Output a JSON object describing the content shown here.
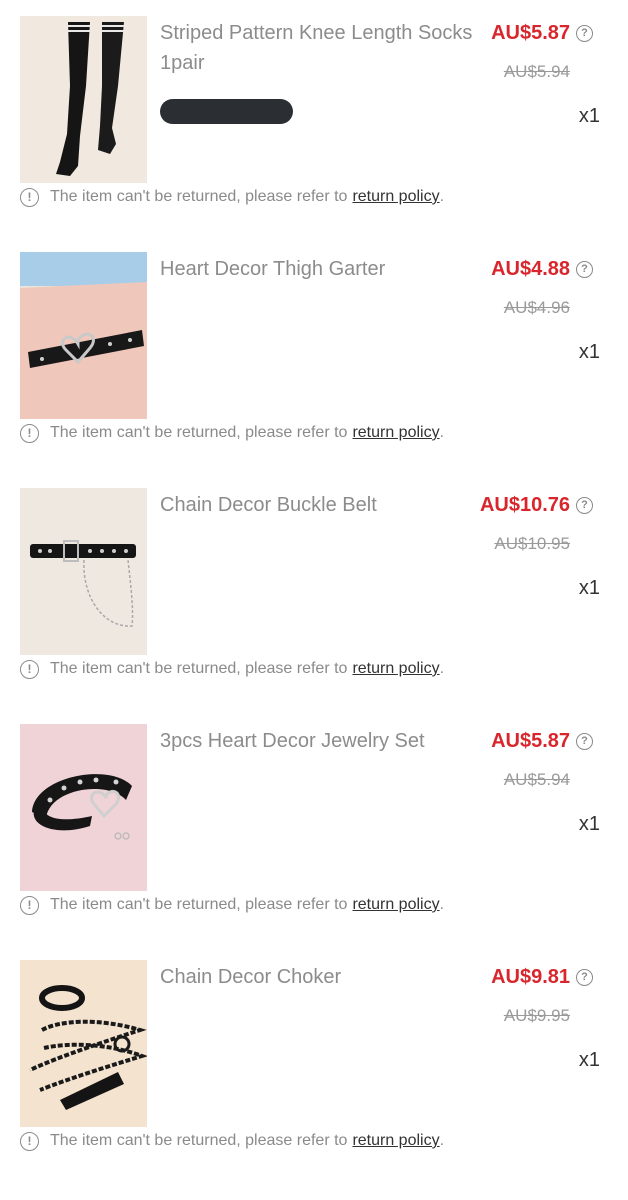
{
  "items": [
    {
      "title": "Striped Pattern Knee Length Socks 1pair",
      "price": "AU$5.87",
      "original_price": "AU$5.94",
      "quantity": "x1",
      "image": "black-knee-socks",
      "notice": "The item can't be returned, please refer to",
      "policy_link": "return policy",
      "period": "."
    },
    {
      "title": "Heart Decor Thigh Garter",
      "price": "AU$4.88",
      "original_price": "AU$4.96",
      "quantity": "x1",
      "image": "heart-thigh-garter",
      "notice": "The item can't be returned, please refer to",
      "policy_link": "return policy",
      "period": "."
    },
    {
      "title": "Chain Decor Buckle Belt",
      "price": "AU$10.76",
      "original_price": "AU$10.95",
      "quantity": "x1",
      "image": "chain-buckle-belt",
      "notice": "The item can't be returned, please refer to",
      "policy_link": "return policy",
      "period": "."
    },
    {
      "title": "3pcs Heart Decor Jewelry Set",
      "price": "AU$5.87",
      "original_price": "AU$5.94",
      "quantity": "x1",
      "image": "heart-choker-set",
      "notice": "The item can't be returned, please refer to",
      "policy_link": "return policy",
      "period": "."
    },
    {
      "title": "Chain Decor Choker",
      "price": "AU$9.81",
      "original_price": "AU$9.95",
      "quantity": "x1",
      "image": "chain-choker-leash",
      "notice": "The item can't be returned, please refer to",
      "policy_link": "return policy",
      "period": "."
    }
  ],
  "icons": {
    "help": "?",
    "info": "!"
  },
  "colors": {
    "price_red": "#d9262c",
    "muted_text": "#8c8c8c",
    "link_text": "#333333"
  }
}
